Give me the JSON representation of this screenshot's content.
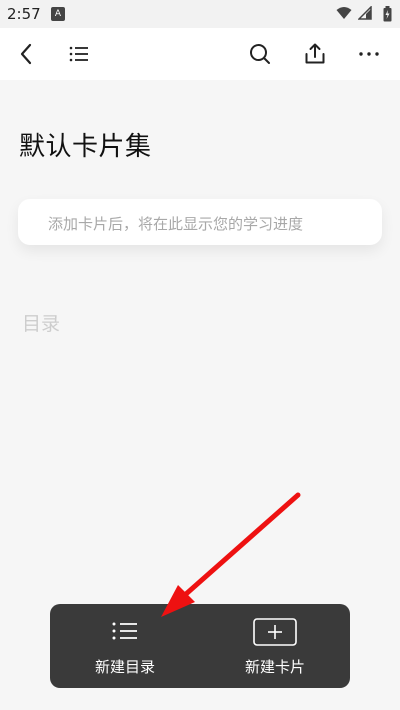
{
  "status_bar": {
    "time": "2:57",
    "app_icon": "A",
    "icons": [
      "wifi-icon",
      "signal-icon",
      "battery-icon"
    ]
  },
  "toolbar": {
    "icons": [
      "back-icon",
      "list-icon",
      "search-icon",
      "share-icon",
      "more-icon"
    ]
  },
  "main": {
    "title": "默认卡片集",
    "progress_placeholder": "添加卡片后，将在此显示您的学习进度",
    "catalog_heading": "目录"
  },
  "bottom_panel": {
    "new_catalog_label": "新建目录",
    "new_card_label": "新建卡片"
  },
  "colors": {
    "panel_bg": "#3a3a3a",
    "annotation_arrow": "#ee1111"
  }
}
